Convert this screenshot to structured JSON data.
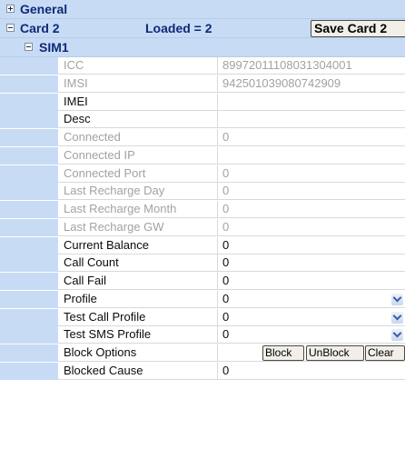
{
  "groups": {
    "general": {
      "title": "General",
      "expanded": false
    },
    "card": {
      "title": "Card 2",
      "loaded": "Loaded = 2",
      "save_label": "Save Card 2",
      "expanded": true
    },
    "sim": {
      "title": "SIM1",
      "expanded": true
    }
  },
  "properties": [
    {
      "name": "ICC",
      "value": "89972011108031304001",
      "disabled": true
    },
    {
      "name": "IMSI",
      "value": "942501039080742909",
      "disabled": true
    },
    {
      "name": "IMEI",
      "value": "",
      "disabled": false
    },
    {
      "name": "Desc",
      "value": "",
      "disabled": false
    },
    {
      "name": "Connected",
      "value": "0",
      "disabled": true
    },
    {
      "name": "Connected IP",
      "value": "",
      "disabled": true
    },
    {
      "name": "Connected Port",
      "value": "0",
      "disabled": true
    },
    {
      "name": "Last Recharge Day",
      "value": "0",
      "disabled": true
    },
    {
      "name": "Last Recharge Month",
      "value": "0",
      "disabled": true
    },
    {
      "name": "Last Recharge GW",
      "value": "0",
      "disabled": true
    },
    {
      "name": "Current Balance",
      "value": "0",
      "disabled": false
    },
    {
      "name": "Call Count",
      "value": "0",
      "disabled": false
    },
    {
      "name": "Call Fail",
      "value": "0",
      "disabled": false
    },
    {
      "name": "Profile",
      "value": "0",
      "disabled": false,
      "dropdown": true
    },
    {
      "name": "Test Call Profile",
      "value": "0",
      "disabled": false,
      "dropdown": true
    },
    {
      "name": "Test SMS Profile",
      "value": "0",
      "disabled": false,
      "dropdown": true
    },
    {
      "name": "Block Options",
      "value": "",
      "disabled": false
    },
    {
      "name": "Blocked Cause",
      "value": "0",
      "disabled": false
    }
  ],
  "block_options": {
    "block_label": "Block",
    "unblock_label": "UnBlock",
    "clear_label": "Clear"
  },
  "icons": {
    "collapsed": "plus-box-icon",
    "expanded": "minus-box-icon",
    "dropdown": "chevron-down-icon"
  },
  "colors": {
    "header_bg": "#c7dbf4",
    "header_text": "#0e2a78",
    "disabled_text": "#a2a2a2"
  }
}
